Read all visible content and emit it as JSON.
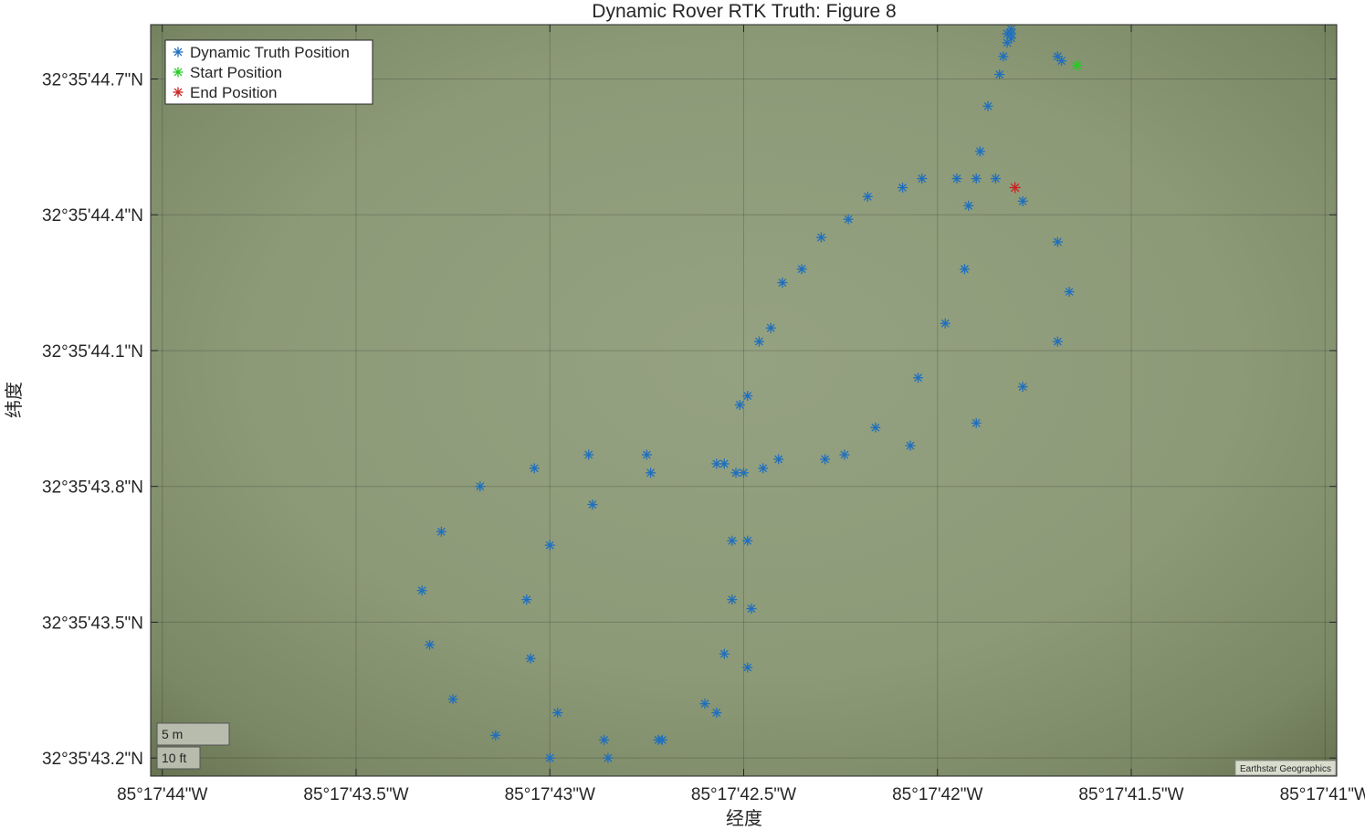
{
  "chart_data": {
    "type": "scatter",
    "title": "Dynamic Rover RTK Truth: Figure 8",
    "xlabel": "经度",
    "ylabel": "纬度",
    "x_unit": "longitude arc-seconds past 85°17' W",
    "y_unit": "latitude arc-seconds past 32°35' N",
    "xlim": [
      44.03,
      40.97
    ],
    "ylim": [
      43.16,
      44.82
    ],
    "x_ticks": [
      44.0,
      43.5,
      43.0,
      42.5,
      42.0,
      41.5,
      41.0
    ],
    "x_tick_labels": [
      "85°17'44\"W",
      "85°17'43.5\"W",
      "85°17'43\"W",
      "85°17'42.5\"W",
      "85°17'42\"W",
      "85°17'41.5\"W",
      "85°17'41\"W"
    ],
    "y_ticks": [
      44.7,
      44.4,
      44.1,
      43.8,
      43.5,
      43.2
    ],
    "y_tick_labels": [
      "32°35'44.7\"N",
      "32°35'44.4\"N",
      "32°35'44.1\"N",
      "32°35'43.8\"N",
      "32°35'43.5\"N",
      "32°35'43.2\"N"
    ],
    "grid": true,
    "legend_position": "top-left",
    "basemap_attribution": "Earthstar Geographics",
    "scale_bar": [
      "5 m",
      "10 ft"
    ],
    "series": [
      {
        "name": "Dynamic Truth Position",
        "color": "#1f6fbf",
        "marker": "asterisk",
        "points": [
          [
            41.81,
            44.81
          ],
          [
            41.81,
            44.8
          ],
          [
            41.82,
            44.8
          ],
          [
            41.81,
            44.79
          ],
          [
            41.82,
            44.78
          ],
          [
            41.84,
            44.71
          ],
          [
            41.87,
            44.64
          ],
          [
            41.89,
            44.54
          ],
          [
            41.9,
            44.48
          ],
          [
            41.85,
            44.48
          ],
          [
            41.92,
            44.42
          ],
          [
            41.95,
            44.48
          ],
          [
            42.04,
            44.48
          ],
          [
            42.09,
            44.46
          ],
          [
            42.18,
            44.44
          ],
          [
            42.23,
            44.39
          ],
          [
            42.3,
            44.35
          ],
          [
            42.35,
            44.28
          ],
          [
            42.4,
            44.25
          ],
          [
            42.43,
            44.15
          ],
          [
            42.46,
            44.12
          ],
          [
            42.49,
            44.0
          ],
          [
            42.51,
            43.98
          ],
          [
            42.52,
            43.83
          ],
          [
            42.5,
            43.83
          ],
          [
            42.57,
            43.85
          ],
          [
            42.55,
            43.85
          ],
          [
            42.45,
            43.84
          ],
          [
            42.41,
            43.86
          ],
          [
            42.29,
            43.86
          ],
          [
            42.24,
            43.87
          ],
          [
            42.16,
            43.93
          ],
          [
            42.07,
            43.89
          ],
          [
            42.05,
            44.04
          ],
          [
            41.98,
            44.16
          ],
          [
            41.93,
            44.28
          ],
          [
            41.9,
            43.94
          ],
          [
            41.78,
            44.02
          ],
          [
            41.69,
            44.12
          ],
          [
            41.66,
            44.23
          ],
          [
            41.69,
            44.34
          ],
          [
            41.78,
            44.43
          ],
          [
            41.69,
            44.75
          ],
          [
            41.68,
            44.74
          ],
          [
            41.83,
            44.75
          ],
          [
            43.18,
            43.8
          ],
          [
            43.04,
            43.84
          ],
          [
            42.9,
            43.87
          ],
          [
            42.75,
            43.87
          ],
          [
            42.74,
            43.83
          ],
          [
            42.89,
            43.76
          ],
          [
            43.0,
            43.67
          ],
          [
            43.28,
            43.7
          ],
          [
            43.33,
            43.57
          ],
          [
            43.06,
            43.55
          ],
          [
            43.31,
            43.45
          ],
          [
            43.05,
            43.42
          ],
          [
            43.25,
            43.33
          ],
          [
            42.98,
            43.3
          ],
          [
            43.14,
            43.25
          ],
          [
            43.0,
            43.2
          ],
          [
            42.86,
            43.24
          ],
          [
            42.85,
            43.2
          ],
          [
            42.72,
            43.24
          ],
          [
            42.71,
            43.24
          ],
          [
            42.6,
            43.32
          ],
          [
            42.57,
            43.3
          ],
          [
            42.53,
            43.68
          ],
          [
            42.49,
            43.68
          ],
          [
            42.53,
            43.55
          ],
          [
            42.48,
            43.53
          ],
          [
            42.55,
            43.43
          ],
          [
            42.49,
            43.4
          ]
        ]
      },
      {
        "name": "Start Position",
        "color": "#22cc22",
        "marker": "asterisk",
        "points": [
          [
            41.64,
            44.73
          ]
        ]
      },
      {
        "name": "End Position",
        "color": "#cc2222",
        "marker": "asterisk",
        "points": [
          [
            41.8,
            44.46
          ]
        ]
      }
    ]
  }
}
